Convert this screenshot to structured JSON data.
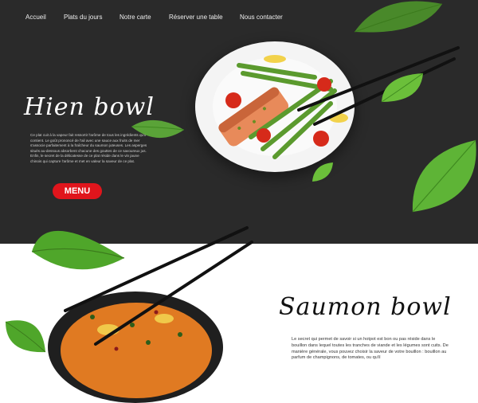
{
  "nav": {
    "items": [
      "Accueil",
      "Plats du jours",
      "Notre carte",
      "Réserver une table",
      "Nous contacter"
    ]
  },
  "dish1": {
    "title": "Hien bowl",
    "description": "Ce plat cuit à la vapeur fait ressortir l'arôme de tous les ingrédients qu'il contient. Le goût prononcé de l'ail avec une sauce aux fruits de mer s'associe parfaitement à la fraîcheur du saumon juteuses. Les asperges situés au-dessous absorbent chacune des gouttes de ce savoureux jus. Enfin, le secret de la délicatesse de ce plat réside dans le vin jaune chinois qui capture l'arôme et met en valeur la saveur de ce plat.",
    "button": "MENU"
  },
  "dish2": {
    "title": "Saumon bowl",
    "description": "Le secret qui permet de savoir si un hotpot est bon ou pas réside dans le bouillon dans lequel toutes les tranches de viande et les légumes sont cuits. De manière générale, vous pouvez choisir la saveur de votre bouillon : bouillon au parfum de champignons, de tomates, ou qu'il"
  },
  "colors": {
    "dark_bg": "#2a2a2a",
    "accent": "#e0151c",
    "leaf": "#5aa632"
  }
}
